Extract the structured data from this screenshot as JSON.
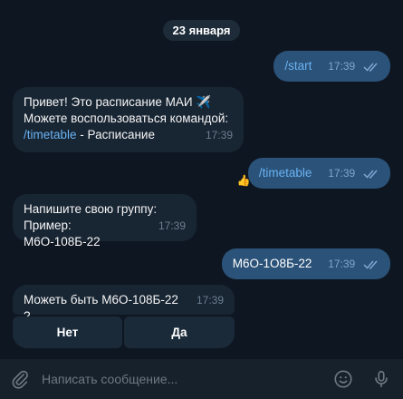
{
  "chat": {
    "date": "23 января",
    "messages": [
      {
        "dir": "out",
        "text": "/start",
        "time": "17:39"
      },
      {
        "dir": "in",
        "line1": "Привет! Это расписание МАИ ✈️",
        "line2": "Можете воспользоваться командой:",
        "link": "/timetable",
        "link_suffix": " - Расписание",
        "time": "17:39"
      },
      {
        "dir": "out",
        "text": "/timetable",
        "time": "17:39",
        "reaction": "👍"
      },
      {
        "dir": "in",
        "line1": "Напишите свою группу:",
        "line2": "Пример: М6О-108Б-22",
        "time": "17:39"
      },
      {
        "dir": "out",
        "text": "М6О-1О8Б-22",
        "time": "17:39"
      },
      {
        "dir": "in",
        "text": "Можеть быть М6О-108Б-22 ?",
        "time": "17:39"
      }
    ],
    "keyboard": {
      "no": "Нет",
      "yes": "Да"
    }
  },
  "input": {
    "placeholder": "Написать сообщение..."
  },
  "icons": {
    "attach": "paperclip-icon",
    "emoji": "smile-icon",
    "mic": "microphone-icon",
    "read": "double-check-icon"
  },
  "colors": {
    "background": "#0e1621",
    "incoming": "#182533",
    "outgoing": "#2b5278",
    "link": "#6ab3f3",
    "input_bar": "#17212b"
  }
}
